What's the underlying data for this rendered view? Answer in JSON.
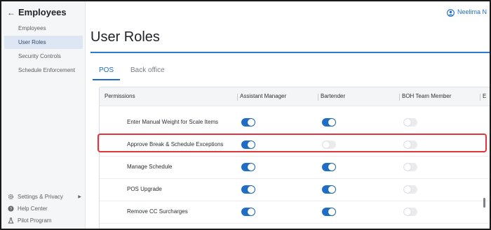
{
  "sidebar": {
    "title": "Employees",
    "items": [
      {
        "label": "Employees",
        "active": false
      },
      {
        "label": "User Roles",
        "active": true
      },
      {
        "label": "Security Controls",
        "active": false
      },
      {
        "label": "Schedule Enforcement",
        "active": false
      }
    ],
    "footer": [
      {
        "label": "Settings & Privacy",
        "icon": "gear-icon",
        "chevron": "▶"
      },
      {
        "label": "Help Center",
        "icon": "help-icon"
      },
      {
        "label": "Pilot Program",
        "icon": "flask-icon"
      }
    ]
  },
  "header": {
    "user_name": "Neelima N"
  },
  "page": {
    "title": "User Roles"
  },
  "tabs": [
    {
      "label": "POS",
      "active": true
    },
    {
      "label": "Back office",
      "active": false
    }
  ],
  "table": {
    "columns": [
      "Permissions",
      "Assistant Manager",
      "Bartender",
      "BOH Team Member",
      "E"
    ],
    "rows": [
      {
        "label": "Enter Manual Weight for Scale Items",
        "values": [
          true,
          true,
          false
        ]
      },
      {
        "label": "Approve Break & Schedule Exceptions",
        "values": [
          true,
          false,
          false
        ],
        "highlighted": true
      },
      {
        "label": "Manage Schedule",
        "values": [
          true,
          true,
          false
        ]
      },
      {
        "label": "POS Upgrade",
        "values": [
          true,
          true,
          false
        ]
      },
      {
        "label": "Remove CC Surcharges",
        "values": [
          true,
          true,
          false
        ]
      }
    ]
  },
  "colors": {
    "accent": "#1e6ec8",
    "highlight": "#e2343a",
    "toggle_off": "#e9ebee",
    "sidebar_bg": "#f5f6f7"
  }
}
